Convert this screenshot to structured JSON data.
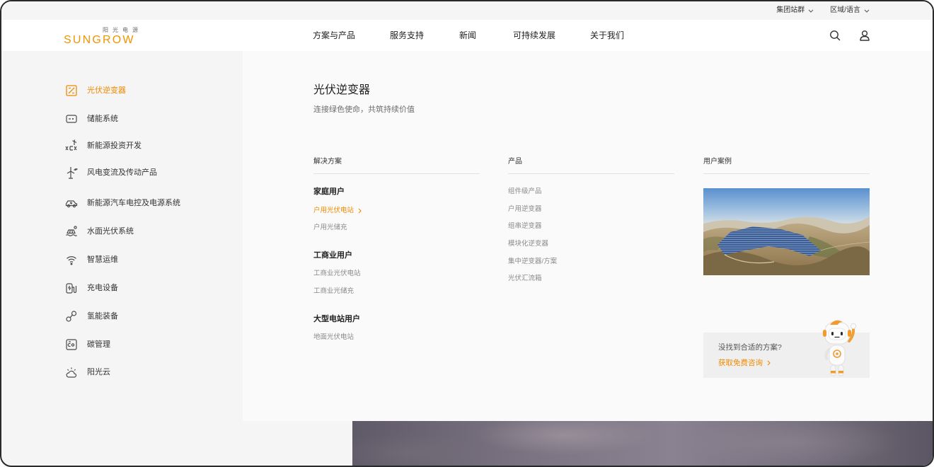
{
  "topbar": {
    "links": [
      {
        "label": "集团站群"
      },
      {
        "label": "区域/语言"
      }
    ]
  },
  "header": {
    "logo_cn": "阳光电源",
    "logo_en": "SUNGROW",
    "nav": [
      {
        "label": "方案与产品"
      },
      {
        "label": "服务支持"
      },
      {
        "label": "新闻"
      },
      {
        "label": "可持续发展"
      },
      {
        "label": "关于我们"
      }
    ],
    "icons": [
      "search-icon",
      "user-icon"
    ]
  },
  "sidebar": {
    "items": [
      {
        "label": "光伏逆变器",
        "icon": "pv-inverter-icon",
        "active": true
      },
      {
        "label": "储能系统",
        "icon": "energy-storage-icon"
      },
      {
        "label": "新能源投资开发",
        "icon": "renewable-investment-icon"
      },
      {
        "label": "风电变流及传动产品",
        "icon": "wind-turbine-icon"
      },
      {
        "label": "新能源汽车电控及电源系统",
        "icon": "electric-vehicle-icon"
      },
      {
        "label": "水面光伏系统",
        "icon": "floating-pv-icon"
      },
      {
        "label": "智慧运维",
        "icon": "smart-om-icon"
      },
      {
        "label": "充电设备",
        "icon": "ev-charger-icon"
      },
      {
        "label": "氢能装备",
        "icon": "hydrogen-icon"
      },
      {
        "label": "碳管理",
        "icon": "carbon-management-icon"
      },
      {
        "label": "阳光云",
        "icon": "cloud-icon"
      }
    ]
  },
  "panel": {
    "title": "光伏逆变器",
    "subtitle": "连接绿色使命，共筑持续价值",
    "solutions": {
      "heading": "解决方案",
      "groups": [
        {
          "title": "家庭用户",
          "links": [
            {
              "label": "户用光伏电站",
              "active": true
            },
            {
              "label": "户用光储充"
            }
          ]
        },
        {
          "title": "工商业用户",
          "links": [
            {
              "label": "工商业光伏电站"
            },
            {
              "label": "工商业光储充"
            }
          ]
        },
        {
          "title": "大型电站用户",
          "links": [
            {
              "label": "地面光伏电站"
            }
          ]
        }
      ]
    },
    "products": {
      "heading": "产品",
      "items": [
        {
          "label": "组件级产品"
        },
        {
          "label": "户用逆变器"
        },
        {
          "label": "组串逆变器"
        },
        {
          "label": "模块化逆变器"
        },
        {
          "label": "集中逆变器/方案"
        },
        {
          "label": "光伏汇流箱"
        }
      ]
    },
    "cases": {
      "heading": "用户案例"
    },
    "cta": {
      "question": "没找到合适的方案?",
      "action": "获取免费咨询"
    }
  },
  "colors": {
    "accent": "#f08a00",
    "text": "#222222",
    "muted": "#8a8a8a",
    "sidebar_bg": "#f5f5f5",
    "panel_bg": "#fafafa"
  }
}
